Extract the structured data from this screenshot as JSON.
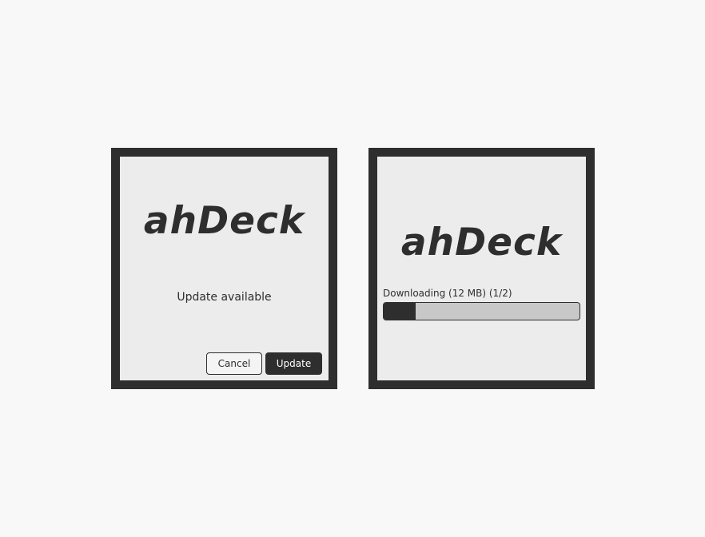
{
  "update_dialog": {
    "logo_text": "ahDeck",
    "message": "Update available",
    "cancel_label": "Cancel",
    "update_label": "Update"
  },
  "download_dialog": {
    "logo_text": "ahDeck",
    "progress_label": "Downloading (12 MB) (1/2)",
    "progress_fraction": 0.165
  },
  "colors": {
    "frame": "#2e2e2e",
    "dialog_bg": "#ececec",
    "page_bg": "#f8f8f8",
    "progress_track": "#c8c8c8",
    "progress_fill": "#2e2e2e"
  }
}
